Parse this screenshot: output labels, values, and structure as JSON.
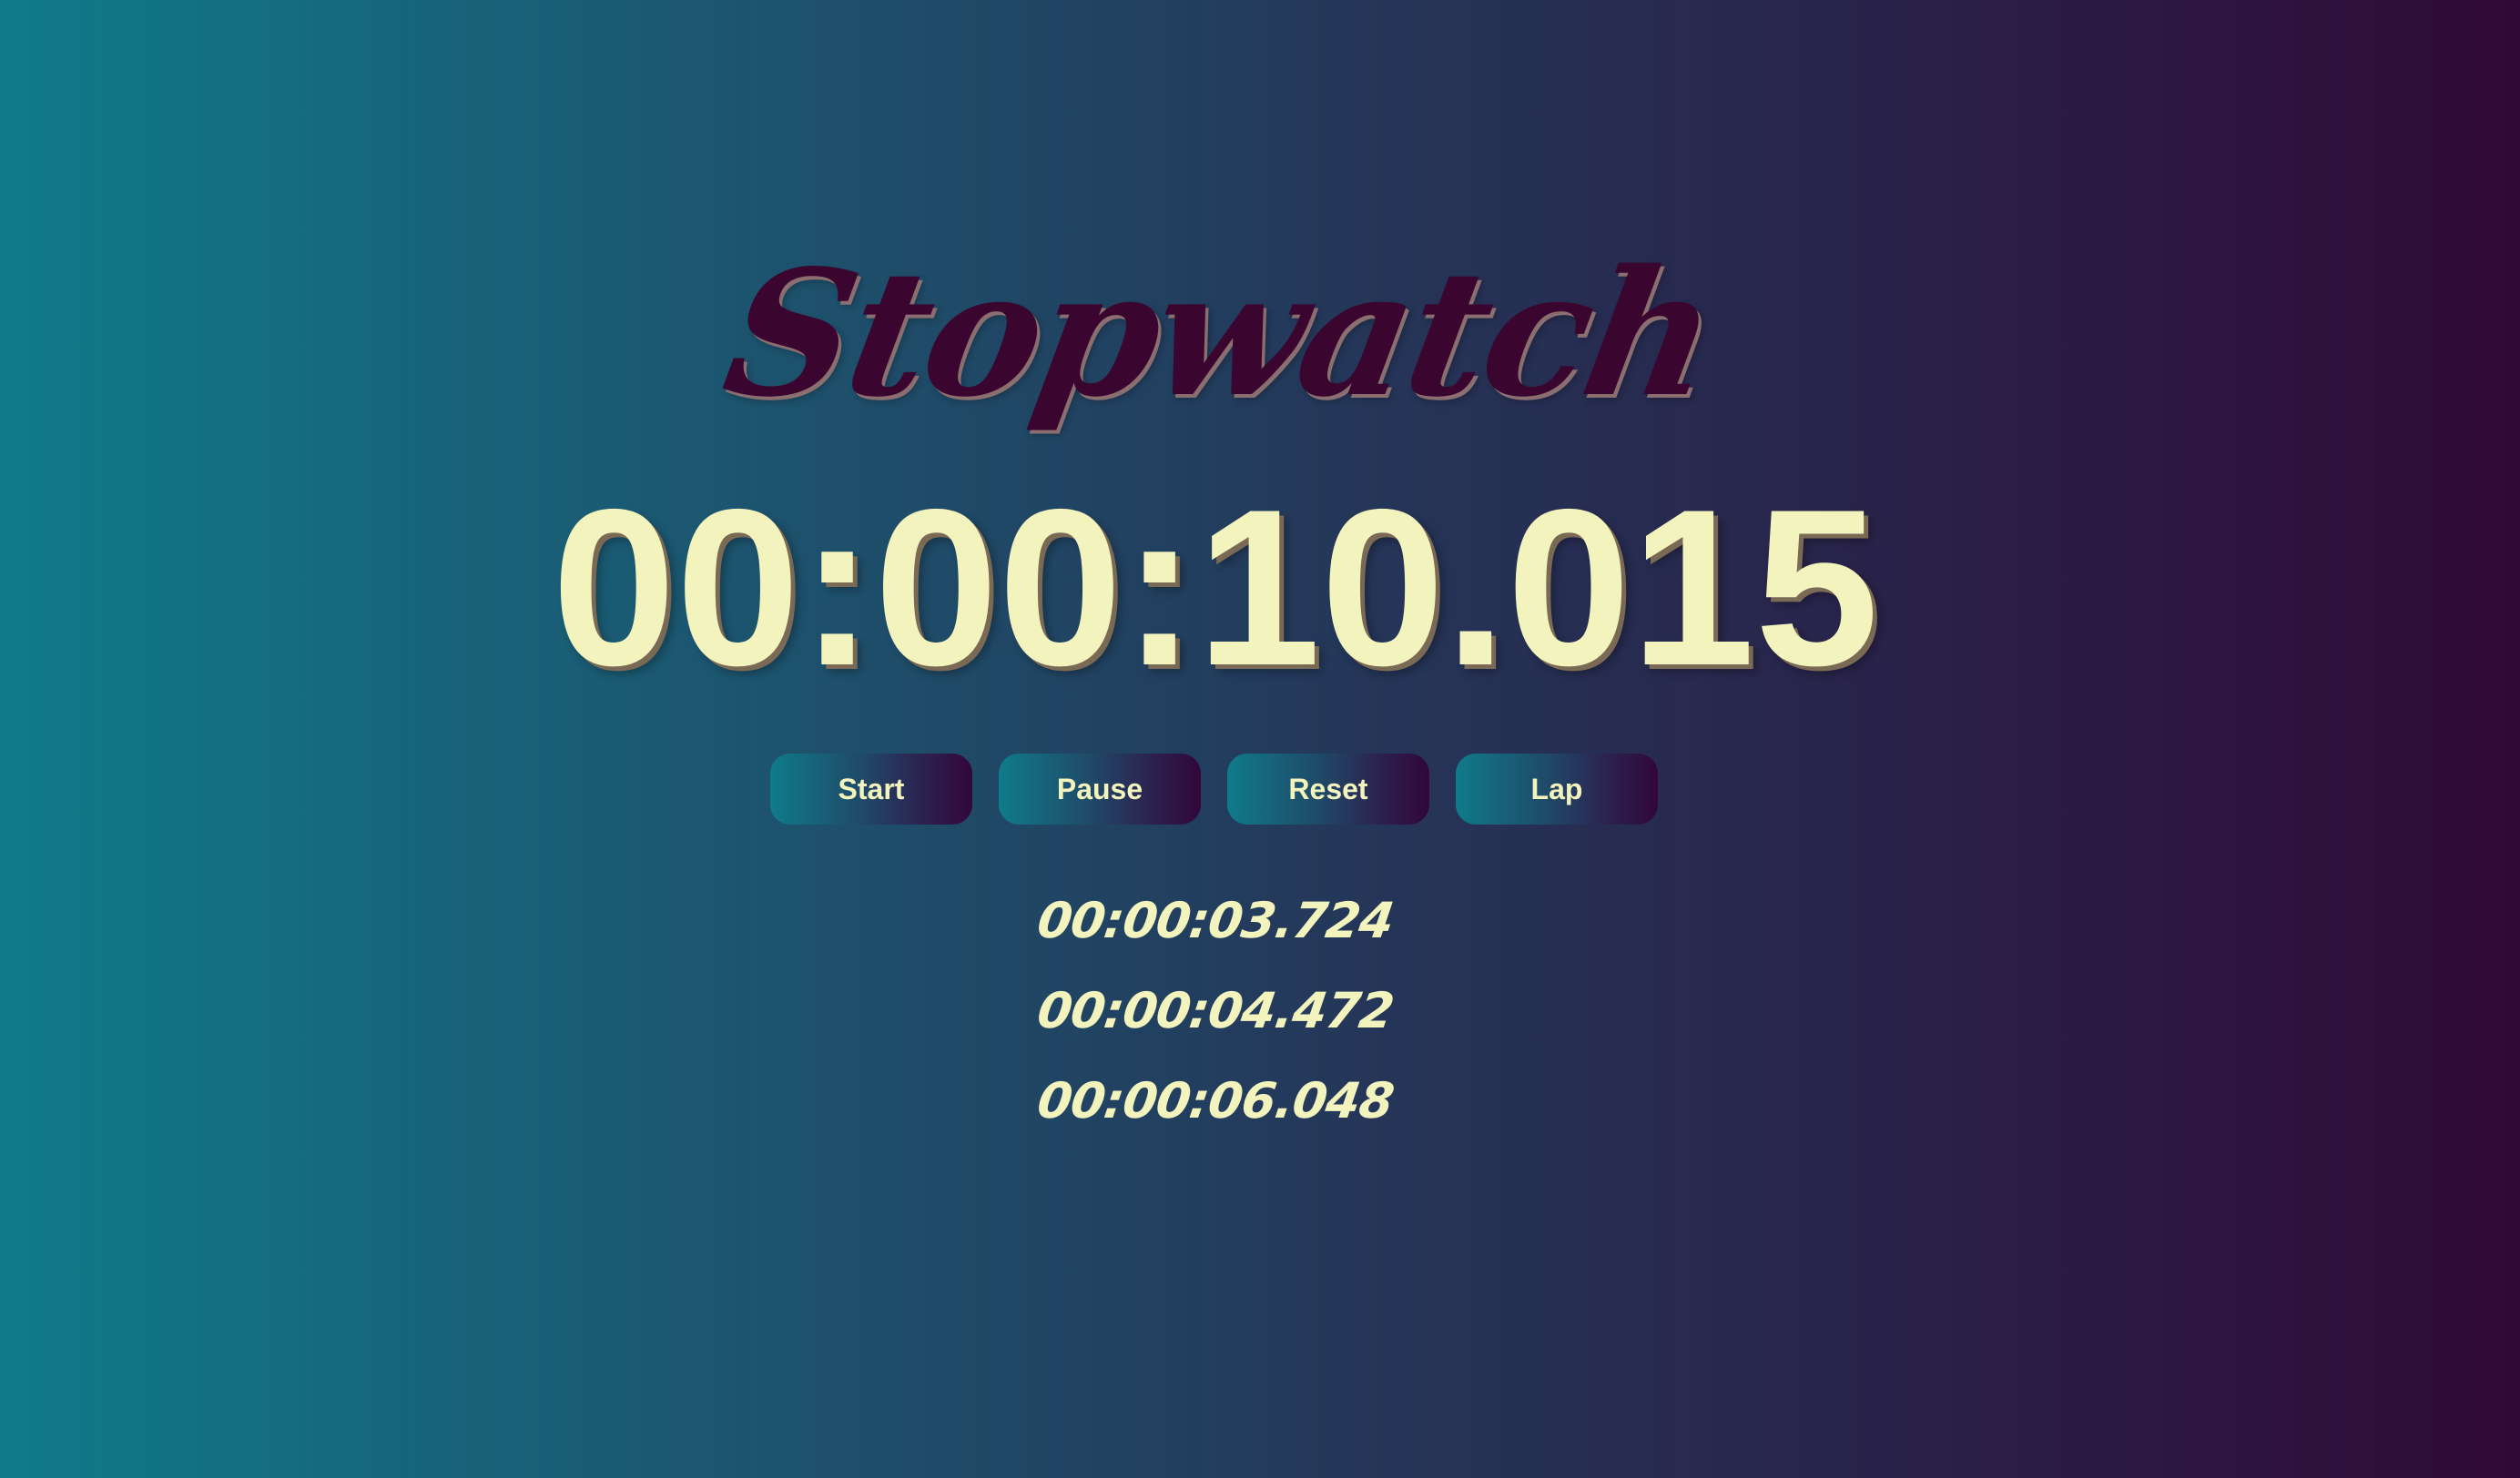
{
  "app": {
    "title": "Stopwatch",
    "colors": {
      "background_left": "#0f7b8a",
      "background_right": "#300a36",
      "title_color": "#3a0630",
      "text_color": "#f3f4bd"
    }
  },
  "display": {
    "time": "00:00:10.015"
  },
  "controls": {
    "start_label": "Start",
    "pause_label": "Pause",
    "reset_label": "Reset",
    "lap_label": "Lap"
  },
  "laps": [
    "00:00:03.724",
    "00:00:04.472",
    "00:00:06.048"
  ]
}
